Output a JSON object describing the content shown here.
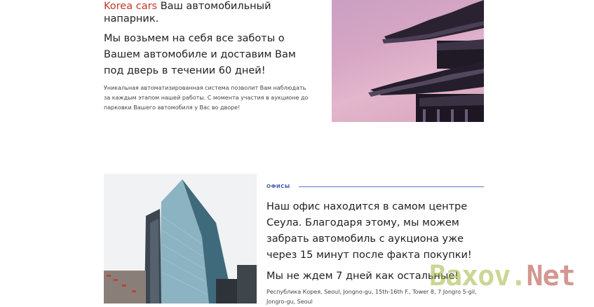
{
  "intro": {
    "brand": "Korea cars",
    "headline_rest": " Ваш автомобильный напарник.",
    "lead": "Мы возьмем на себя все заботы о Вашем автомобиле и доставим Вам под дверь в течении 60 дней!",
    "small": "Уникальная автоматизированная система позволит Вам наблюдать за каждым этапом нашей работы. С момента участия в аукционе до парковки Вашего автомобиля у Вас во дворе!"
  },
  "offices": {
    "label": "ОФИСЫ",
    "text": "Наш офис находится в самом центре Сеула. Благодаря этому, мы можем забрать автомобиль с аукциона уже через 15 минут после факта покупки!",
    "text2": "Мы не ждем 7 дней как остальные!",
    "address": "Республика Корея, Seoul, Jongno-gu, 15th-16th F., Tower 8, 7 Jongro 5-gil, Jongro-gu, Seoul"
  },
  "watermark": {
    "main": "Baxov.",
    "net": "Net"
  },
  "colors": {
    "brand": "#c0392b",
    "accent": "#3b5ba5"
  }
}
